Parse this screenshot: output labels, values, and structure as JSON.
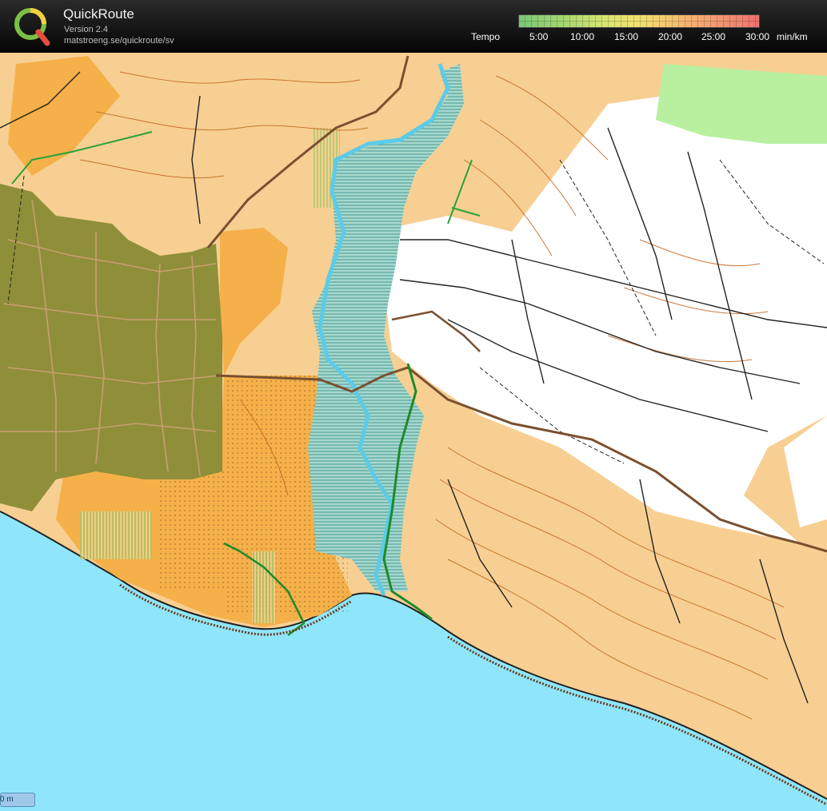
{
  "header": {
    "title": "QuickRoute",
    "version": "Version 2.4",
    "url": "matstroeng.se/quickroute/sv",
    "logo_letter": "Q"
  },
  "legend": {
    "label": "Tempo",
    "ticks": [
      "5:00",
      "10:00",
      "15:00",
      "20:00",
      "25:00",
      "30:00"
    ],
    "unit": "min/km",
    "colors": {
      "fast": "#78c878",
      "mid": "#f2e070",
      "slow": "#ee7070"
    }
  },
  "map": {
    "colors": {
      "open_land": "#f7cf92",
      "rough_open": "#f5b04a",
      "forest": "#ffffff",
      "green": "#b9f0a0",
      "settlement": "#8f8f3a",
      "water": "#8fe6fb",
      "marsh": "#a7d8cc",
      "contour": "#c0651f",
      "path": "#222222"
    },
    "scale_label": "0 m"
  }
}
